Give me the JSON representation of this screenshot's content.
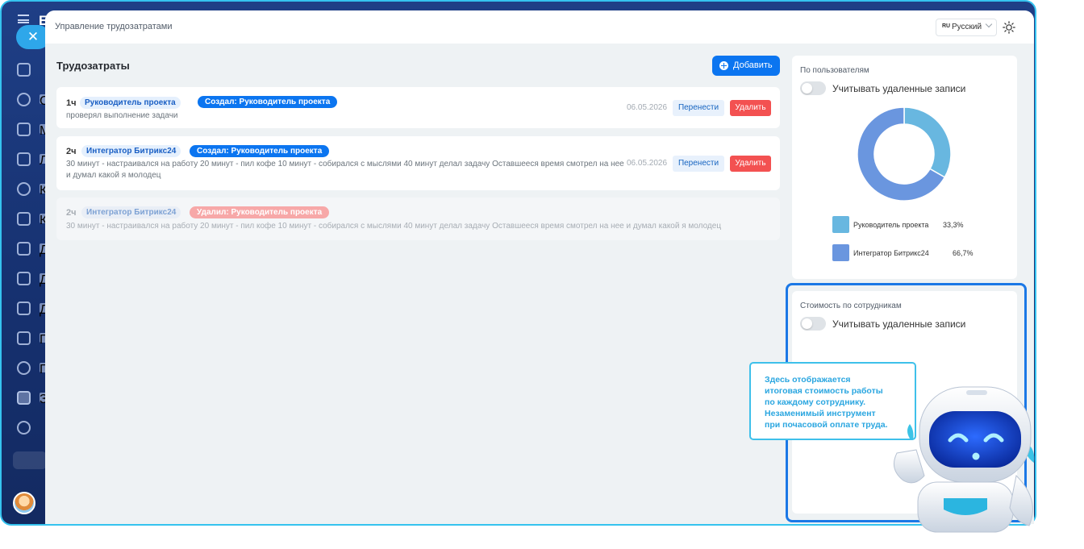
{
  "app": {
    "logo_text": "Б",
    "sidebar_letters": [
      "С",
      "М",
      "Л",
      "К",
      "К",
      "Д",
      "Д",
      "Д",
      "П",
      "Г",
      "З"
    ]
  },
  "panel": {
    "title": "Управление трудозатратами",
    "language": {
      "code": "RU",
      "label": "Русский"
    }
  },
  "worklog": {
    "title": "Трудозатраты",
    "add_label": "Добавить",
    "move_label": "Перенести",
    "delete_label": "Удалить",
    "entries": [
      {
        "hours": "1ч",
        "user": "Руководитель проекта",
        "status": "Создал: Руководитель проекта",
        "description": "проверял выполнение задачи",
        "date": "06.05.2026"
      },
      {
        "hours": "2ч",
        "user": "Интегратор Битрикс24",
        "status": "Создал: Руководитель проекта",
        "description": "30 минут - настраивался на работу 20 минут - пил кофе 10 минут - собирался с мыслями 40 минут делал задачу Оставшееся время смотрел на нее и думал какой я молодец",
        "date": "06.05.2026"
      },
      {
        "hours": "2ч",
        "user": "Интегратор Битрикс24",
        "status": "Удалил: Руководитель проекта",
        "description": "30 минут - настраивался на работу 20 минут - пил кофе 10 минут - собирался с мыслями 40 минут делал задачу Оставшееся время смотрел на нее и думал какой я молодец",
        "deleted": true
      }
    ]
  },
  "by_users": {
    "title": "По пользователям",
    "toggle_label": "Учитывать удаленные записи",
    "toggle_on": false
  },
  "cost_by_employees": {
    "title": "Стоимость по сотрудникам",
    "toggle_label": "Учитывать удаленные записи",
    "toggle_on": false
  },
  "chart_data": {
    "type": "pie",
    "categories": [
      "Руководитель проекта",
      "Интегратор Битрикс24"
    ],
    "values": [
      33.3,
      66.7
    ],
    "labels": [
      "33,3%",
      "66,7%"
    ],
    "colors": [
      "#68b7e0",
      "#6a96df"
    ]
  },
  "tooltip": {
    "lines": [
      "Здесь отображается",
      "итоговая стоимость работы",
      "по каждому сотруднику.",
      "Незаменимый инструмент",
      "при почасовой оплате труда."
    ]
  },
  "colors": {
    "accent": "#0b75f0",
    "danger": "#f35151",
    "highlight": "#1b78e6",
    "tooltip_border": "#3ec0ea"
  }
}
